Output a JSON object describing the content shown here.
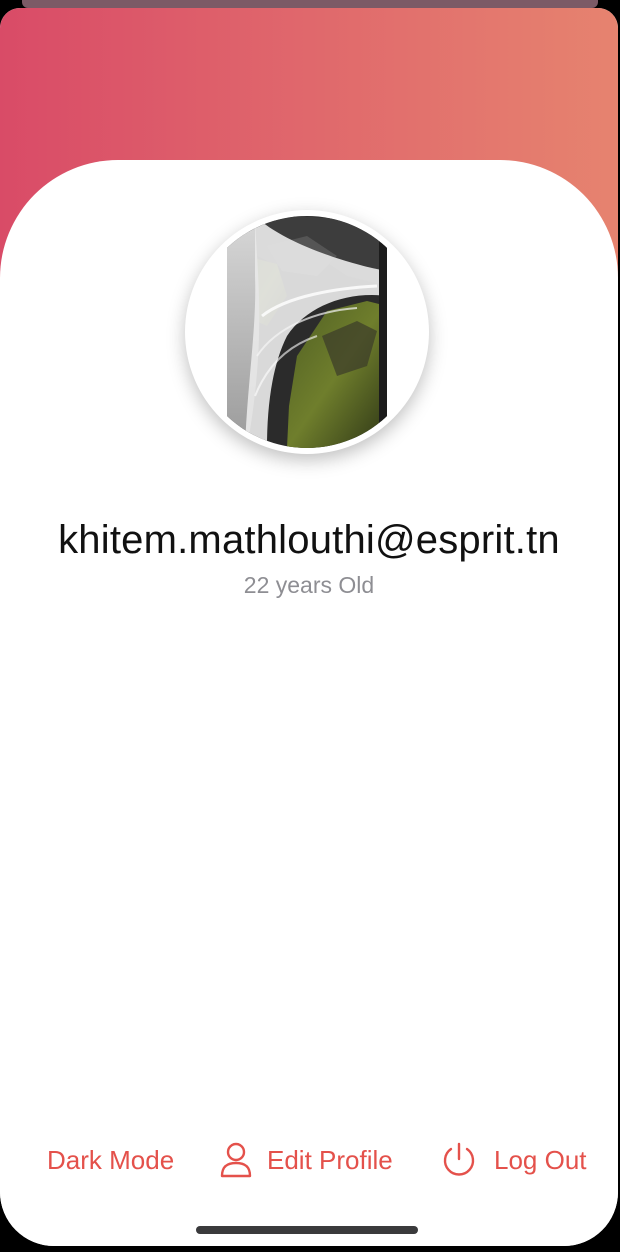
{
  "profile": {
    "email": "khitem.mathlouthi@esprit.tn",
    "age_text": "22 years Old",
    "avatar_icon": "waterfall-photo"
  },
  "actions": {
    "dark_mode": {
      "label": "Dark Mode"
    },
    "edit_profile": {
      "label": "Edit Profile",
      "icon": "person-icon"
    },
    "log_out": {
      "label": "Log Out",
      "icon": "power-icon"
    }
  },
  "colors": {
    "gradient_start": "#d94b67",
    "gradient_end": "#e6836f",
    "accent": "#e4514b",
    "secondary_text": "#8e8e93"
  }
}
